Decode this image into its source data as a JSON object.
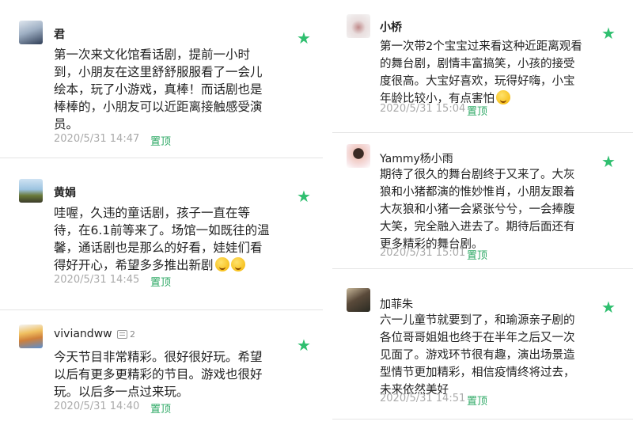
{
  "comments_left": [
    {
      "name": "君",
      "avatar": "avatar-photo",
      "text_lines": [
        "第一次来文化馆看话剧，提前一小时",
        "到，小朋友在这里舒舒服服看了一会儿",
        "绘本，玩了小游戏，真棒！而话剧也是",
        "棒棒的，小朋友可以近距离接触感受演",
        "员。"
      ],
      "time": "2020/5/31 14:47",
      "pin": "置顶"
    },
    {
      "name": "黄娟",
      "avatar": "avatar-photo",
      "text_lines": [
        "哇喔，久违的童话剧，孩子一直在等",
        "待，在6.1前等来了。场馆一如既往的温",
        "馨，通话剧也是那么的好看，娃娃们看",
        "得好开心，希望多多推出新剧"
      ],
      "emoji_count": 2,
      "time": "2020/5/31 14:45",
      "pin": "置顶"
    },
    {
      "name": "viviandww",
      "avatar": "avatar-photo",
      "reply_count": "2",
      "text_lines": [
        "今天节目非常精彩。很好很好玩。希望",
        "以后有更多更精彩的节目。游戏也很好",
        "玩。以后多一点过来玩。"
      ],
      "time": "2020/5/31 14:40",
      "pin": "置顶"
    }
  ],
  "comments_right": [
    {
      "name": "小桥",
      "avatar": "avatar-photo",
      "text_lines": [
        "第一次带2个宝宝过来看这种近距离观看",
        "的舞台剧，剧情丰富搞笑，小孩的接受",
        "度很高。大宝好喜欢，玩得好嗨，小宝",
        "年龄比较小，有点害怕"
      ],
      "emoji_count": 1,
      "time": "2020/5/31 15:04",
      "pin": "置顶"
    },
    {
      "name": "Yammy杨小雨",
      "avatar": "avatar-photo",
      "text_lines": [
        "期待了很久的舞台剧终于又来了。大灰",
        "狼和小猪都演的惟妙惟肖，小朋友跟着",
        "大灰狼和小猪一会紧张兮兮，一会捧腹",
        "大笑，完全融入进去了。期待后面还有",
        "更多精彩的舞台剧。"
      ],
      "time": "2020/5/31 15:01",
      "pin": "置顶"
    },
    {
      "name": "加菲朱",
      "avatar": "avatar-photo",
      "text_lines": [
        "六一儿童节就要到了，和瑜源亲子剧的",
        "各位哥哥姐姐也终于在半年之后又一次",
        "见面了。游戏环节很有趣，演出场景造",
        "型情节更加精彩，相信疫情终将过去，",
        "未来依然美好"
      ],
      "time": "2020/5/31 14:51",
      "pin": "置顶"
    }
  ],
  "colors": {
    "accent_green": "#2fbf6f",
    "pin_green": "#2fa966",
    "meta_gray": "#aaaaaa"
  }
}
